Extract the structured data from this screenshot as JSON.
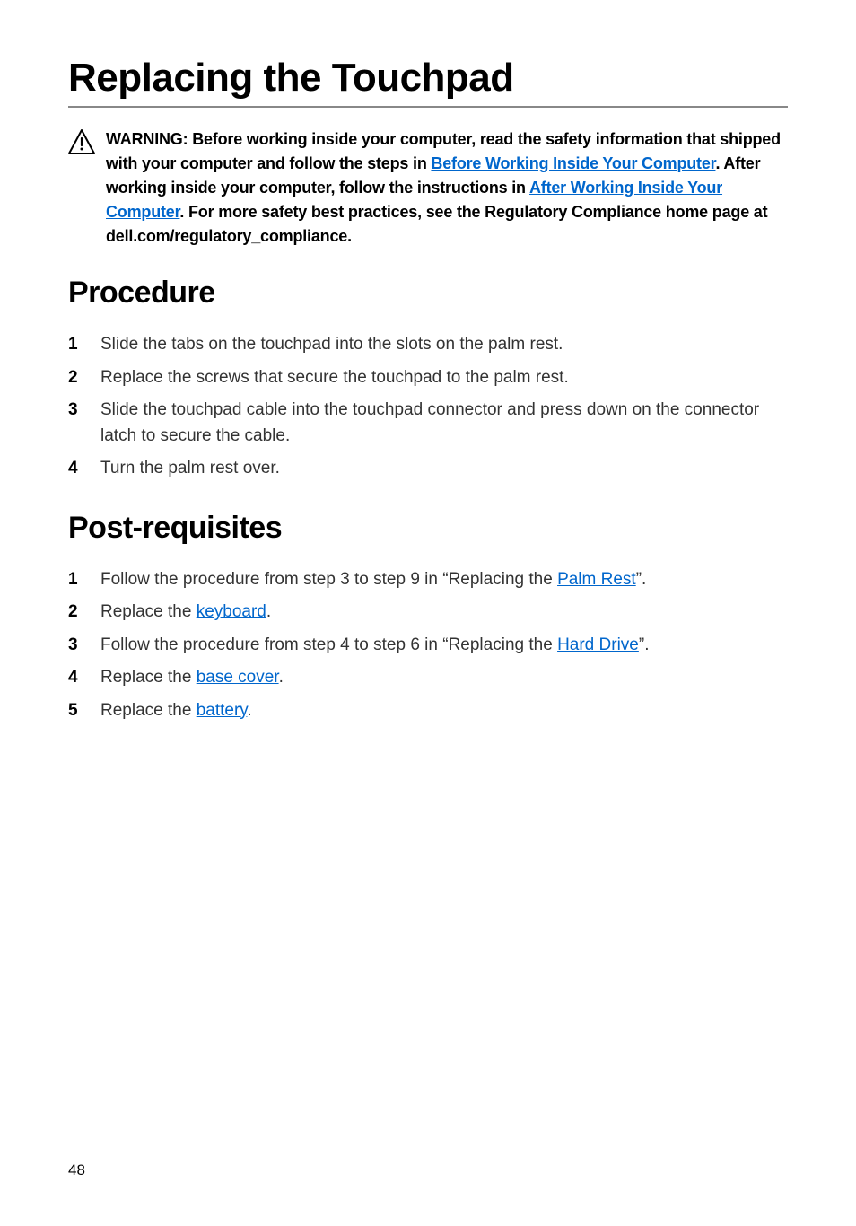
{
  "title": "Replacing the Touchpad",
  "warning": {
    "part1": "WARNING: Before working inside your computer, read the safety information that shipped with your computer and follow the steps in ",
    "link1_text": "Before Working Inside Your Computer",
    "part2": ". After working inside your computer, follow the instructions in ",
    "link2_text": "After Working Inside Your Computer",
    "part3": ". For more safety best practices, see the Regulatory Compliance home page at dell.com/regulatory_compliance."
  },
  "procedure": {
    "heading": "Procedure",
    "steps": [
      "Slide the tabs on the touchpad into the slots on the palm rest.",
      "Replace the screws that secure the touchpad to the palm rest.",
      "Slide the touchpad cable into the touchpad connector and press down on the connector latch to secure the cable.",
      "Turn the palm rest over."
    ]
  },
  "post_requisites": {
    "heading": "Post-requisites",
    "steps": [
      {
        "pre": "Follow the procedure from step 3 to step 9 in “Replacing the ",
        "link": "Palm Rest",
        "post": "”."
      },
      {
        "pre": "Replace the ",
        "link": "keyboard",
        "post": "."
      },
      {
        "pre": "Follow the procedure from step 4 to step 6 in “Replacing the ",
        "link": "Hard Drive",
        "post": "”."
      },
      {
        "pre": "Replace the ",
        "link": "base cover",
        "post": "."
      },
      {
        "pre": "Replace the ",
        "link": "battery",
        "post": "."
      }
    ]
  },
  "page_number": "48"
}
